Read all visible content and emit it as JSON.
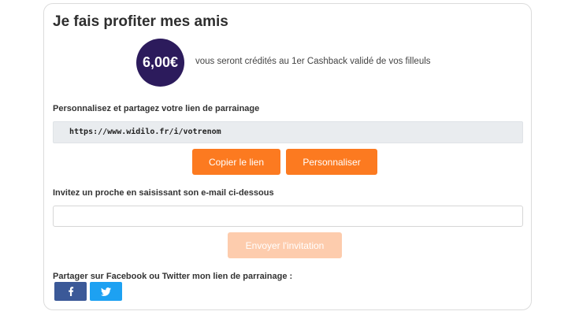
{
  "title": "Je fais profiter mes amis",
  "reward": {
    "amount": "6,00€",
    "text": "vous seront crédités au 1er Cashback validé de vos filleuls"
  },
  "share": {
    "label": "Personnalisez et partagez votre lien de parrainage",
    "link": "https://www.widilo.fr/i/votrenom",
    "copy_button": "Copier le lien",
    "customize_button": "Personnaliser"
  },
  "invite": {
    "label": "Invitez un proche en saisissant son e-mail ci-dessous",
    "email_value": "",
    "send_button": "Envoyer l'invitation"
  },
  "social": {
    "label": "Partager sur Facebook ou Twitter mon lien de parrainage :",
    "facebook_icon": "facebook-icon",
    "twitter_icon": "twitter-icon"
  },
  "colors": {
    "accent": "#fc7a20",
    "accent_disabled": "#fdccad",
    "badge": "#2c1b5c",
    "facebook": "#3b5998",
    "twitter": "#1da1f2"
  }
}
